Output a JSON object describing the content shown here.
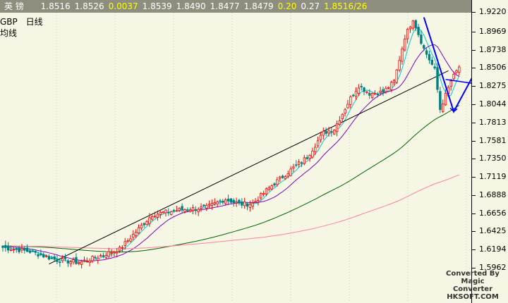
{
  "header": {
    "name": "英  镑",
    "fields": [
      "1.8516",
      "1.8526",
      "0.0037",
      "1.8539",
      "1.8490",
      "1.8477",
      "1.8479",
      "0.20",
      "0.27",
      "1.8516/26"
    ],
    "highlight_indices": [
      2,
      7,
      9
    ]
  },
  "symbol": {
    "code": "GBP",
    "period": "日线",
    "line2": "均线"
  },
  "watermark": {
    "line1": "Converted By",
    "line2": "Magic Converter",
    "line3": "HKSOFT.COM"
  },
  "chart_data": {
    "type": "candlestick",
    "y_ticks": [
      "1.9220",
      "1.8969",
      "1.8738",
      "1.8506",
      "1.8275",
      "1.8044",
      "1.7813",
      "1.7581",
      "1.7350",
      "1.7119",
      "1.6888",
      "1.6656",
      "1.6425",
      "1.6194",
      "1.5962"
    ],
    "ylim": [
      1.5855,
      1.9245
    ],
    "n_bars": 160,
    "anchors": [
      [
        0,
        1.622
      ],
      [
        10,
        1.617
      ],
      [
        20,
        1.606
      ],
      [
        28,
        1.603
      ],
      [
        34,
        1.609
      ],
      [
        43,
        1.62
      ],
      [
        55,
        1.664
      ],
      [
        65,
        1.67
      ],
      [
        75,
        1.673
      ],
      [
        82,
        1.684
      ],
      [
        87,
        1.677
      ],
      [
        92,
        1.678
      ],
      [
        98,
        1.698
      ],
      [
        105,
        1.718
      ],
      [
        112,
        1.737
      ],
      [
        118,
        1.768
      ],
      [
        122,
        1.773
      ],
      [
        128,
        1.812
      ],
      [
        131,
        1.828
      ],
      [
        135,
        1.818
      ],
      [
        140,
        1.82
      ],
      [
        144,
        1.833
      ],
      [
        148,
        1.89
      ],
      [
        151,
        1.913
      ],
      [
        155,
        1.875
      ],
      [
        159,
        1.848
      ],
      [
        161,
        1.798
      ],
      [
        165,
        1.834
      ],
      [
        168,
        1.852
      ]
    ],
    "colors": {
      "up": "#ff0000",
      "down": "#008080",
      "ma_fast": "#00c8d8",
      "ma_mid": "#7a00c8",
      "ma_slow": "#006400",
      "ma_long": "#ff80a0",
      "trend": "#000000",
      "pattern": "#0000ff"
    },
    "trendline": [
      [
        17,
        1.601
      ],
      [
        164,
        1.847
      ]
    ],
    "pattern": {
      "main": [
        [
          155,
          1.915
        ],
        [
          166,
          1.795
        ],
        [
          176,
          1.859
        ],
        [
          181,
          1.836
        ]
      ],
      "inner": [
        [
          163,
          1.836
        ],
        [
          175,
          1.83
        ]
      ],
      "arrows": [
        [
          166,
          1.795
        ],
        [
          176,
          1.859
        ],
        [
          181,
          1.836
        ]
      ]
    }
  }
}
